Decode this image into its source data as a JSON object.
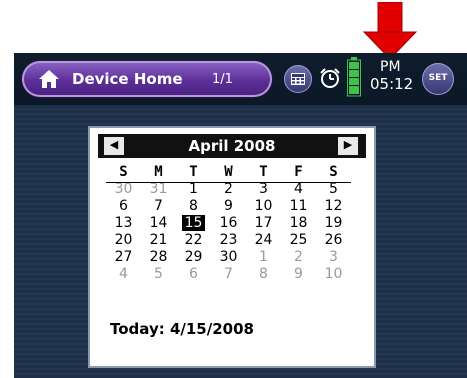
{
  "status_bar": {
    "home_label": "Device Home",
    "page_indicator": "1/1",
    "clock_ampm": "PM",
    "clock_time": "05:12",
    "set_label": "SET"
  },
  "calendar": {
    "month_title": "April 2008",
    "prev_glyph": "◀",
    "next_glyph": "▶",
    "weekdays": [
      "S",
      "M",
      "T",
      "W",
      "T",
      "F",
      "S"
    ],
    "weeks": [
      [
        "30",
        "31",
        "1",
        "2",
        "3",
        "4",
        "5"
      ],
      [
        "6",
        "7",
        "8",
        "9",
        "10",
        "11",
        "12"
      ],
      [
        "13",
        "14",
        "15",
        "16",
        "17",
        "18",
        "19"
      ],
      [
        "20",
        "21",
        "22",
        "23",
        "24",
        "25",
        "26"
      ],
      [
        "27",
        "28",
        "29",
        "30",
        "1",
        "2",
        "3"
      ],
      [
        "4",
        "5",
        "6",
        "7",
        "8",
        "9",
        "10"
      ]
    ],
    "selected_day": "15",
    "today_text": "Today: 4/15/2008"
  },
  "colors": {
    "annotation_arrow": "#e00000",
    "home_button": "#5c2f98",
    "device_bg": "#1a2a3d",
    "battery": "#3fc34a"
  },
  "icons": [
    "home-icon",
    "calculator-icon",
    "alarm-clock-icon",
    "battery-icon",
    "annotation-arrow"
  ]
}
